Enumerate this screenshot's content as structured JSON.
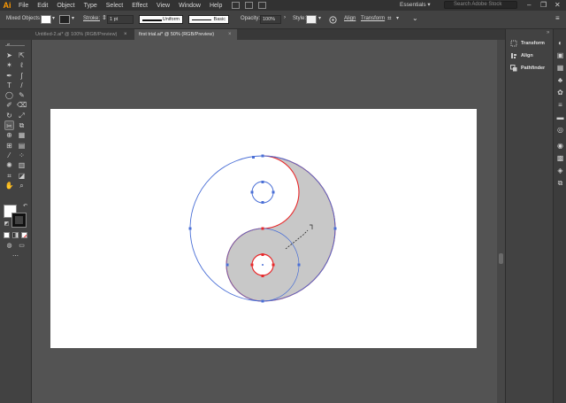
{
  "app": {
    "logo": "Ai",
    "menus": [
      "File",
      "Edit",
      "Object",
      "Type",
      "Select",
      "Effect",
      "View",
      "Window",
      "Help"
    ],
    "workspace": "Essentials",
    "search_placeholder": "Search Adobe Stock",
    "window_controls": [
      "–",
      "❐",
      "✕"
    ]
  },
  "control_bar": {
    "selection_label": "Mixed Objects",
    "stroke_label": "Stroke:",
    "stroke_weight": "1 pt",
    "profile_label": "Uniform",
    "brush_label": "Basic",
    "opacity_label": "Opacity:",
    "opacity_value": "100%",
    "style_label": "Style:",
    "align_label": "Align",
    "transform_label": "Transform"
  },
  "tabs": [
    {
      "label": "Untitled-2.ai* @ 100% (RGB/Preview)",
      "close": "×",
      "active": false
    },
    {
      "label": "first trial.ai* @ 50% (RGB/Preview)",
      "close": "×",
      "active": true
    }
  ],
  "right_panel": {
    "items": [
      {
        "label": "Transform",
        "icon": "transform-icon"
      },
      {
        "label": "Align",
        "icon": "align-icon"
      },
      {
        "label": "Pathfinder",
        "icon": "pathfinder-icon"
      }
    ]
  },
  "colors": {
    "accent": "#ff9a00",
    "selection_blue": "#4a6fd6",
    "selection_red": "#e8292b",
    "fill_gray": "#c8c8c8"
  }
}
